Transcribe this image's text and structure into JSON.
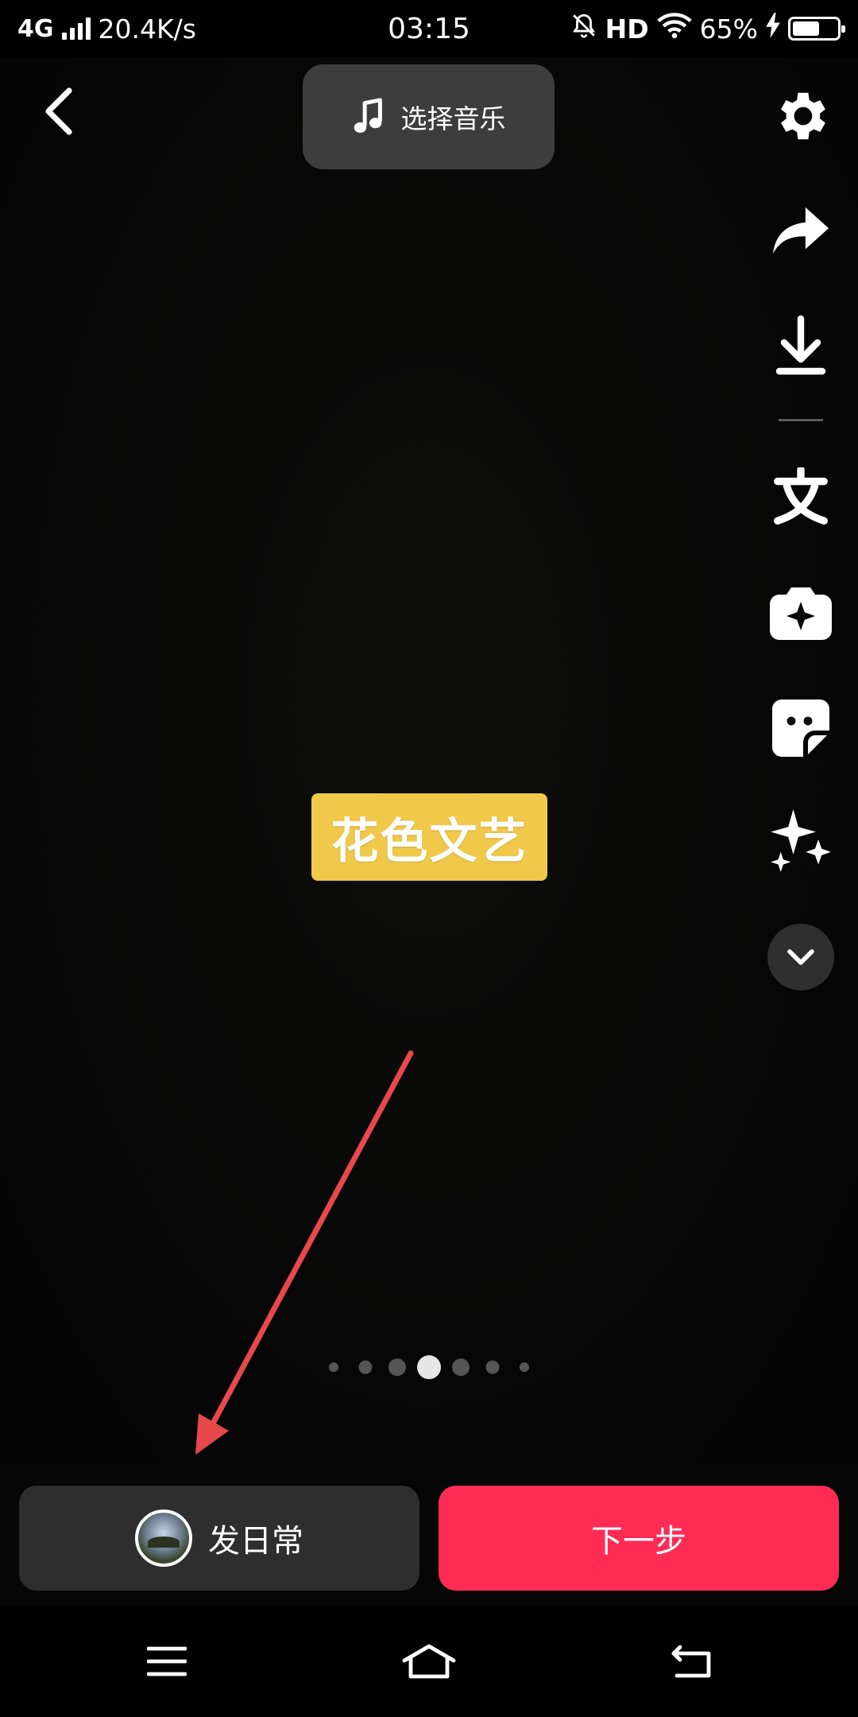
{
  "status_bar": {
    "network": "4G",
    "speed": "20.4K/s",
    "time": "03:15",
    "hd": "HD",
    "battery_percent": "65%",
    "battery_level": 0.65,
    "icons": [
      "signal-icon",
      "mute-bell-icon",
      "wifi-icon",
      "charging-icon",
      "battery-icon"
    ]
  },
  "header": {
    "back_icon": "chevron-left-icon",
    "music_button_label": "选择音乐",
    "music_icon": "music-note-icon"
  },
  "toolbar": {
    "items": [
      "settings-icon",
      "share-icon",
      "download-icon",
      "text-icon",
      "effects-icon",
      "sticker-icon",
      "sparkle-icon",
      "chevron-down-icon"
    ]
  },
  "canvas": {
    "sticker_text": "花色文艺",
    "sticker_color": "#f1c94a"
  },
  "page_indicator": {
    "count": 7,
    "active_index": 3
  },
  "bottom": {
    "daily_button_label": "发日常",
    "next_button_label": "下一步",
    "accent_color": "#fe2c55"
  },
  "nav_bar": {
    "icons": [
      "menu-icon",
      "home-icon",
      "back-icon"
    ]
  }
}
